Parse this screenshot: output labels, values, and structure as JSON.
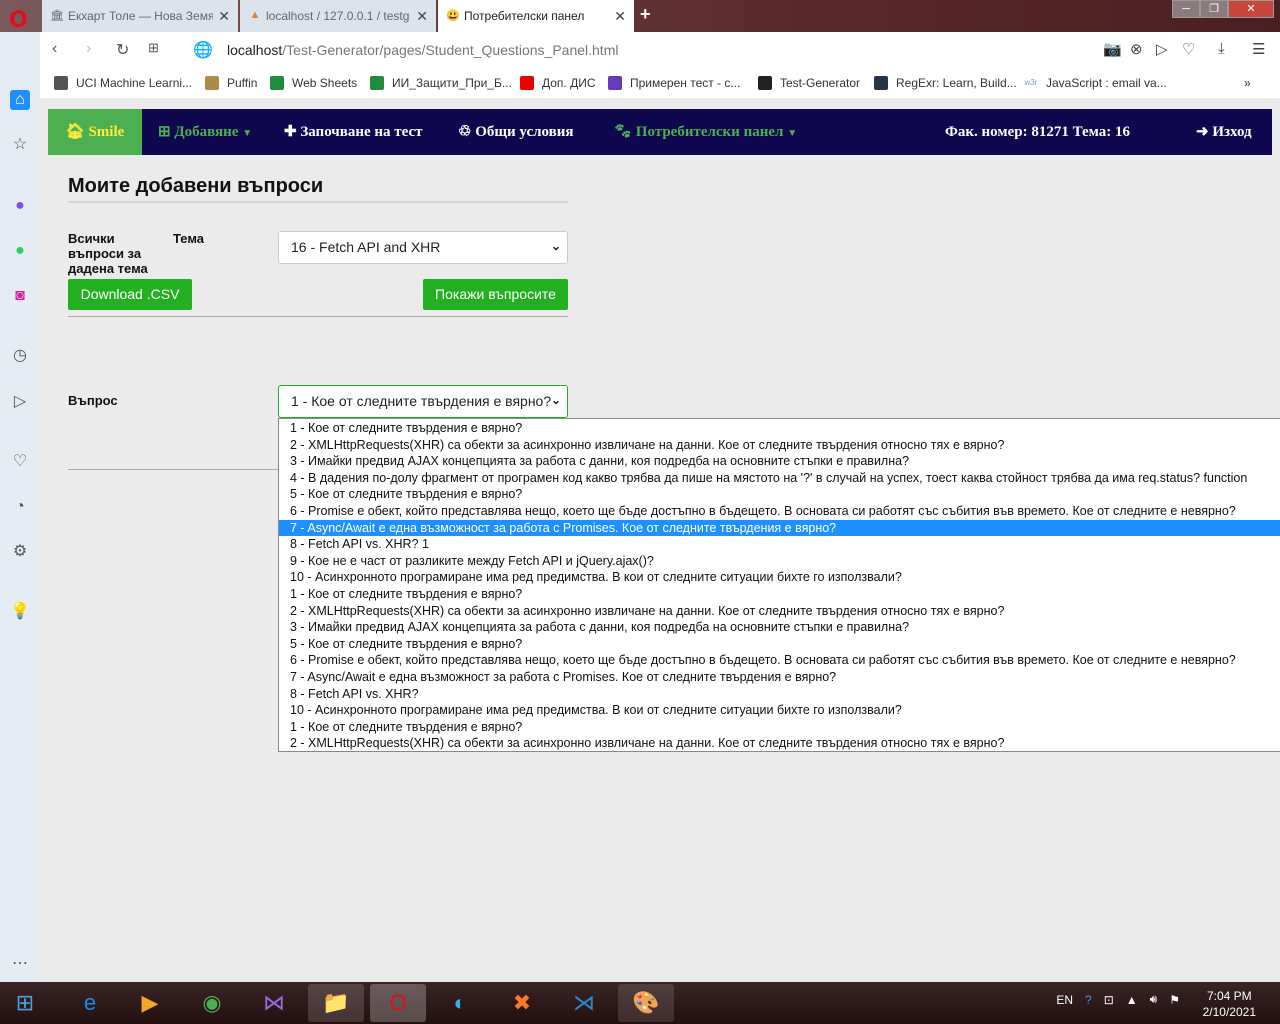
{
  "browser": {
    "tabs": [
      {
        "title": "Екхарт Толе — Нова Земя",
        "icon": "museum-icon"
      },
      {
        "title": "localhost / 127.0.0.1 / testg",
        "icon": "phpmyadmin-icon"
      },
      {
        "title": "Потребителски панел",
        "icon": "smiley-icon",
        "active": true
      }
    ],
    "url_host": "localhost",
    "url_path": "/Test-Generator/pages/Student_Questions_Panel.html",
    "bookmarks": [
      {
        "label": "UCI Machine Learni...",
        "icon": "document-icon",
        "color": "#555"
      },
      {
        "label": "Puffin",
        "icon": "puffin-icon",
        "color": "#b08a4a"
      },
      {
        "label": "Web Sheets",
        "icon": "sheets-icon",
        "color": "#1e8e3e"
      },
      {
        "label": "ИИ_Защити_При_Б...",
        "icon": "sheets-icon",
        "color": "#1e8e3e"
      },
      {
        "label": "Доп. ДИС",
        "icon": "youtube-icon",
        "color": "#e00"
      },
      {
        "label": "Примерен тест - с...",
        "icon": "forms-icon",
        "color": "#673ab7"
      },
      {
        "label": "Test-Generator",
        "icon": "github-icon",
        "color": "#222"
      },
      {
        "label": "RegExr: Learn, Build...",
        "icon": "regexr-icon",
        "color": "#263544"
      },
      {
        "label": "JavaScript : email va...",
        "icon": "w3r-icon",
        "color": "#fff"
      }
    ]
  },
  "navbar": {
    "home": "Smile",
    "add": "Добавяне",
    "start_test": "Започване на тест",
    "terms": "Общи условия",
    "user_panel": "Потребителски панел",
    "info": "Фак. номер: 81271 Тема: 16",
    "logout": "Изход"
  },
  "main": {
    "title": "Моите добавени въпроси",
    "all_questions_label": "Всички въпроси за дадена тема",
    "topic_label": "Тема",
    "topic_value": "16 - Fetch API and XHR",
    "download_button": "Download .CSV",
    "show_button": "Покажи въпросите",
    "question_label": "Въпрос",
    "question_value": "1 - Кое от следните твърдения е вярно?",
    "selected_index": 6,
    "options": [
      "1 - Кое от следните твърдения е вярно?",
      "2 - XMLHttpRequests(XHR) са обекти за асинхронно извличане на данни. Кое от следните твърдения относно тях е вярно?",
      "3 - Имайки предвид AJAX концепцията за работа с данни, коя подредба на основните стъпки е правилна?",
      "4 - В дадения по-долу фрагмент от програмен код какво трябва да пише на мястото на '?' в случай на успех, тоест каква стойност трябва да има req.status? function",
      "5 - Кое от следните твърдения е вярно?",
      "6 - Promise е обект, който представлява нещо, което ще бъде достъпно в бъдещето. В основата си работят със събития във времето. Кое от следните е невярно?",
      "7 - Async/Await е една възможност за работа с Promises. Кое от следните твърдения е вярно?",
      "8 - Fetch API vs. XHR? 1",
      "9 - Кое не е част от разликите между Fetch API и jQuery.ajax()?",
      "10 - Асинхронното програмиране има ред предимства. В кои от следните ситуации бихте го използвали?",
      "1 - Кое от следните твърдения е вярно?",
      "2 - XMLHttpRequests(XHR) са обекти за асинхронно извличане на данни. Кое от следните твърдения относно тях е вярно?",
      "3 - Имайки предвид AJAX концепцията за работа с данни, коя подредба на основните стъпки е правилна?",
      "5 - Кое от следните твърдения е вярно?",
      "6 - Promise е обект, който представлява нещо, което ще бъде достъпно в бъдещето. В основата си работят със събития във времето. Кое от следните е невярно?",
      "7 - Async/Await е една възможност за работа с Promises. Кое от следните твърдения е вярно?",
      "8 - Fetch API vs. XHR?",
      "10 - Асинхронното програмиране има ред предимства. В кои от следните ситуации бихте го използвали?",
      "1 - Кое от следните твърдения е вярно?",
      "2 - XMLHttpRequests(XHR) са обекти за асинхронно извличане на данни. Кое от следните твърдения относно тях е вярно?"
    ]
  },
  "taskbar": {
    "lang": "EN",
    "time": "7:04 PM",
    "date": "2/10/2021"
  },
  "colors": {
    "navbar": "#10084e",
    "accent_green": "#4caf50",
    "button_green": "#22b022",
    "highlight": "#1e90ff"
  }
}
